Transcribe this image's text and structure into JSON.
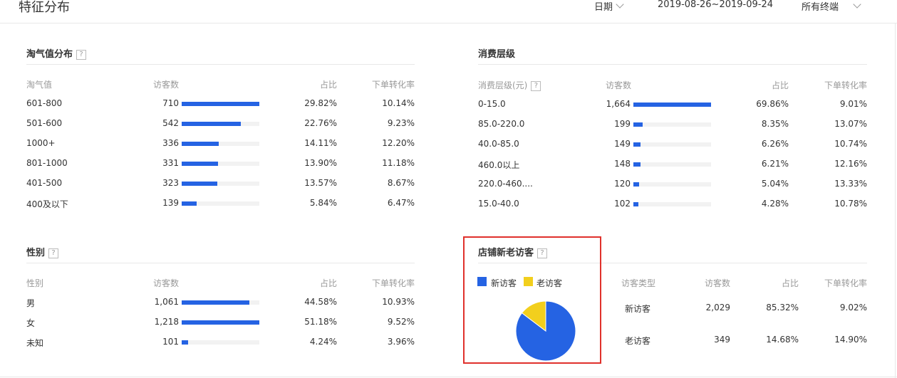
{
  "header": {
    "title": "特征分布",
    "date_label": "日期",
    "date_range": "2019-08-26~2019-09-24",
    "terminal": "所有终端"
  },
  "taoqi": {
    "title": "淘气值分布",
    "help": "?",
    "columns": [
      "淘气值",
      "访客数",
      "占比",
      "下单转化率"
    ],
    "rows": [
      {
        "label": "601-800",
        "visitors": "710",
        "ratio": "29.82%",
        "conversion": "10.14%",
        "bar": 1.0
      },
      {
        "label": "501-600",
        "visitors": "542",
        "ratio": "22.76%",
        "conversion": "9.23%",
        "bar": 0.763
      },
      {
        "label": "1000+",
        "visitors": "336",
        "ratio": "14.11%",
        "conversion": "12.20%",
        "bar": 0.473
      },
      {
        "label": "801-1000",
        "visitors": "331",
        "ratio": "13.90%",
        "conversion": "11.18%",
        "bar": 0.466
      },
      {
        "label": "401-500",
        "visitors": "323",
        "ratio": "13.57%",
        "conversion": "8.67%",
        "bar": 0.455
      },
      {
        "label": "400及以下",
        "visitors": "139",
        "ratio": "5.84%",
        "conversion": "6.47%",
        "bar": 0.196
      }
    ]
  },
  "consumption": {
    "title": "消费层级",
    "columns": [
      "消费层级(元)",
      "访客数",
      "占比",
      "下单转化率"
    ],
    "help": "?",
    "rows": [
      {
        "label": "0-15.0",
        "visitors": "1,664",
        "ratio": "69.86%",
        "conversion": "9.01%",
        "bar": 1.0
      },
      {
        "label": "85.0-220.0",
        "visitors": "199",
        "ratio": "8.35%",
        "conversion": "13.07%",
        "bar": 0.12
      },
      {
        "label": "40.0-85.0",
        "visitors": "149",
        "ratio": "6.26%",
        "conversion": "10.74%",
        "bar": 0.09
      },
      {
        "label": "460.0以上",
        "visitors": "148",
        "ratio": "6.21%",
        "conversion": "12.16%",
        "bar": 0.089
      },
      {
        "label": "220.0-460....",
        "visitors": "120",
        "ratio": "5.04%",
        "conversion": "13.33%",
        "bar": 0.072
      },
      {
        "label": "15.0-40.0",
        "visitors": "102",
        "ratio": "4.28%",
        "conversion": "10.78%",
        "bar": 0.061
      }
    ]
  },
  "gender": {
    "title": "性别",
    "help": "?",
    "columns": [
      "性别",
      "访客数",
      "占比",
      "下单转化率"
    ],
    "rows": [
      {
        "label": "男",
        "visitors": "1,061",
        "ratio": "44.58%",
        "conversion": "10.93%",
        "bar": 0.871
      },
      {
        "label": "女",
        "visitors": "1,218",
        "ratio": "51.18%",
        "conversion": "9.52%",
        "bar": 1.0
      },
      {
        "label": "未知",
        "visitors": "101",
        "ratio": "4.24%",
        "conversion": "3.96%",
        "bar": 0.083
      }
    ]
  },
  "new_old": {
    "title": "店铺新老访客",
    "help": "?",
    "legend": [
      {
        "label": "新访客",
        "color": "#2563e3"
      },
      {
        "label": "老访客",
        "color": "#f2cf1d"
      }
    ],
    "columns": [
      "访客类型",
      "访客数",
      "占比",
      "下单转化率"
    ],
    "rows": [
      {
        "label": "新访客",
        "visitors": "2,029",
        "ratio": "85.32%",
        "conversion": "9.02%"
      },
      {
        "label": "老访客",
        "visitors": "349",
        "ratio": "14.68%",
        "conversion": "14.90%"
      }
    ]
  },
  "chart_data": {
    "type": "pie",
    "categories": [
      "新访客",
      "老访客"
    ],
    "values": [
      85.32,
      14.68
    ],
    "colors": [
      "#2563e3",
      "#f2cf1d"
    ]
  },
  "colors": {
    "bar": "#2563e3",
    "bar_track": "#f2f2f2",
    "highlight": "#e0312c"
  }
}
